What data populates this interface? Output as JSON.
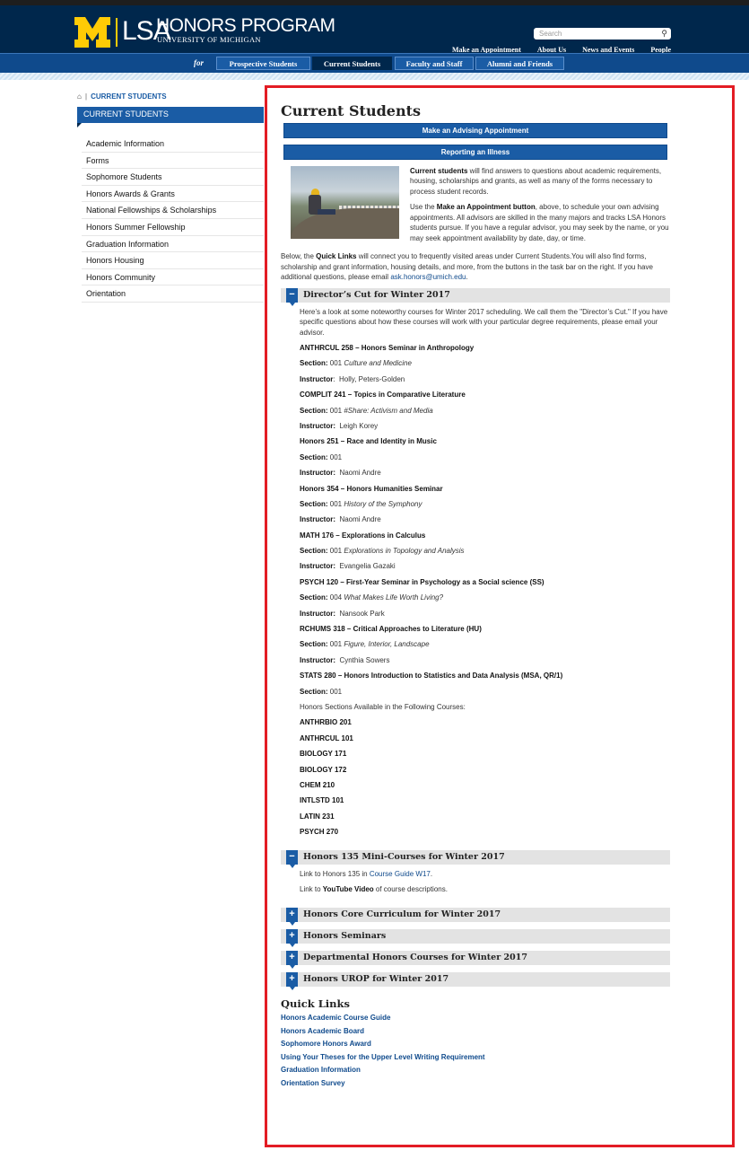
{
  "header": {
    "logo_lsa": "LSA",
    "logo_title": "HONORS PROGRAM",
    "logo_sub": "UNIVERSITY OF MICHIGAN",
    "search_placeholder": "Search",
    "util_nav": [
      "Make an Appointment",
      "About Us",
      "News and Events",
      "People"
    ]
  },
  "nav": {
    "for_label": "for",
    "tabs": [
      "Prospective Students",
      "Current Students",
      "Faculty and Staff",
      "Alumni and Friends"
    ]
  },
  "breadcrumb": {
    "current": "CURRENT STUDENTS"
  },
  "sidebar": {
    "title": "CURRENT STUDENTS",
    "items": [
      "Academic Information",
      "Forms",
      "Sophomore Students",
      "Honors Awards & Grants",
      "National Fellowships & Scholarships",
      "Honors Summer Fellowship",
      "Graduation Information",
      "Honors Housing",
      "Honors Community",
      "Orientation"
    ]
  },
  "main": {
    "title": "Current Students",
    "btn_appointment": "Make an Advising Appointment",
    "btn_illness": "Reporting an Illness",
    "intro1_bold": "Current students",
    "intro1_rest": " will find answers to questions about academic requirements, housing, scholarships and grants, as well as many of the forms necessary to process student records.",
    "intro2_a": "Use the ",
    "intro2_bold": "Make an Appointment button",
    "intro2_b": ", above, to schedule your own advising appointments. All advisors are skilled in the many majors and tracks LSA Honors students pursue. If you have a regular advisor, you may seek by the name, or you may seek appointment availability by date, day, or time.",
    "para_a": "Below, the ",
    "para_bold": "Quick Links",
    "para_b": " will connect you to frequently visited areas under Current Students.You will also find forms, scholarship and grant information, housing details, and more, from the buttons in the task bar on the right. If you have additional questions, please email ",
    "para_email": "ask.honors@umich.edu",
    "para_end": "."
  },
  "accordion1": {
    "title": "Director’s Cut for Winter 2017",
    "icon": "−",
    "intro": "Here’s a look at some noteworthy courses for Winter 2017 scheduling. We call them the \"Director’s Cut.\" If you have specific questions about how these courses will work with your particular degree requirements, please email your advisor.",
    "rows": [
      {
        "b": "ANTHRCUL 258 – Honors Seminar in Anthropology"
      },
      {
        "l": "Section:",
        "v": " 001 ",
        "i": "Culture and Medicine"
      },
      {
        "l": "Instructor",
        "v": ":  Holly, Peters-Golden"
      },
      {
        "b": "COMPLIT 241 – Topics in Comparative Literature"
      },
      {
        "l": "Section:",
        "v": " 001 ",
        "i": "#Share: Activism and Media"
      },
      {
        "l": "Instructor:",
        "v": "  Leigh Korey"
      },
      {
        "b": "Honors 251 – Race and Identity in Music"
      },
      {
        "l": "Section:",
        "v": " 001"
      },
      {
        "l": "Instructor:",
        "v": "  Naomi Andre"
      },
      {
        "b": "Honors 354 – Honors Humanities Seminar"
      },
      {
        "l": "Section:",
        "v": " 001 ",
        "i": "History of the Symphony"
      },
      {
        "l": "Instructor:",
        "v": "  Naomi Andre"
      },
      {
        "b": "MATH 176 – Explorations in Calculus"
      },
      {
        "l": "Section:",
        "v": " 001 ",
        "i": "Explorations in Topology and Analysis"
      },
      {
        "l": "Instructor:",
        "v": "  Evangelia Gazaki"
      },
      {
        "b": "PSYCH 120 – First-Year Seminar in Psychology as a Social science (SS)"
      },
      {
        "l": "Section:",
        "v": " 004 ",
        "i": "What Makes Life Worth Living?"
      },
      {
        "l": "Instructor:",
        "v": "  Nansook Park"
      },
      {
        "b": "RCHUMS 318 – Critical Approaches to Literature (HU)"
      },
      {
        "l": "Section:",
        "v": " 001 ",
        "i": "Figure, Interior, Landscape"
      },
      {
        "l": "Instructor:",
        "v": "  Cynthia Sowers"
      },
      {
        "b": "STATS 280 – Honors Introduction to Statistics and Data Analysis (MSA, QR/1)"
      },
      {
        "l": "Section:",
        "v": " 001"
      },
      {
        "t": "Honors Sections Available in the Following Courses:"
      },
      {
        "b": "ANTHRBIO 201"
      },
      {
        "b": "ANTHRCUL 101"
      },
      {
        "b": "BIOLOGY 171"
      },
      {
        "b": "BIOLOGY 172"
      },
      {
        "b": "CHEM 210"
      },
      {
        "b": "INTLSTD 101"
      },
      {
        "b": "LATIN 231"
      },
      {
        "b": "PSYCH 270"
      }
    ]
  },
  "accordion2": {
    "title": "Honors 135 Mini-Courses for Winter 2017",
    "icon": "−",
    "line1_a": "Link to Honors 135 in ",
    "line1_link": "Course Guide W17",
    "line1_end": ".",
    "line2_a": "Link to ",
    "line2_link": "YouTube Video",
    "line2_end": " of course descriptions."
  },
  "collapsed": [
    {
      "title": "Honors Core Curriculum for Winter 2017",
      "icon": "+"
    },
    {
      "title": "Honors Seminars",
      "icon": "+"
    },
    {
      "title": "Departmental Honors Courses for Winter 2017",
      "icon": "+"
    },
    {
      "title": "Honors UROP for Winter 2017",
      "icon": "+"
    }
  ],
  "quick_links": {
    "title": "Quick Links",
    "links": [
      "Honors Academic Course Guide",
      "Honors Academic Board",
      "Sophomore Honors Award",
      "Using Your Theses for the Upper Level Writing Requirement",
      "Graduation Information",
      "Orientation Survey"
    ]
  },
  "colors": {
    "navy": "#00274c",
    "maize": "#ffcb05",
    "blue": "#1a5ca5",
    "highlight_frame": "#e31c24"
  }
}
